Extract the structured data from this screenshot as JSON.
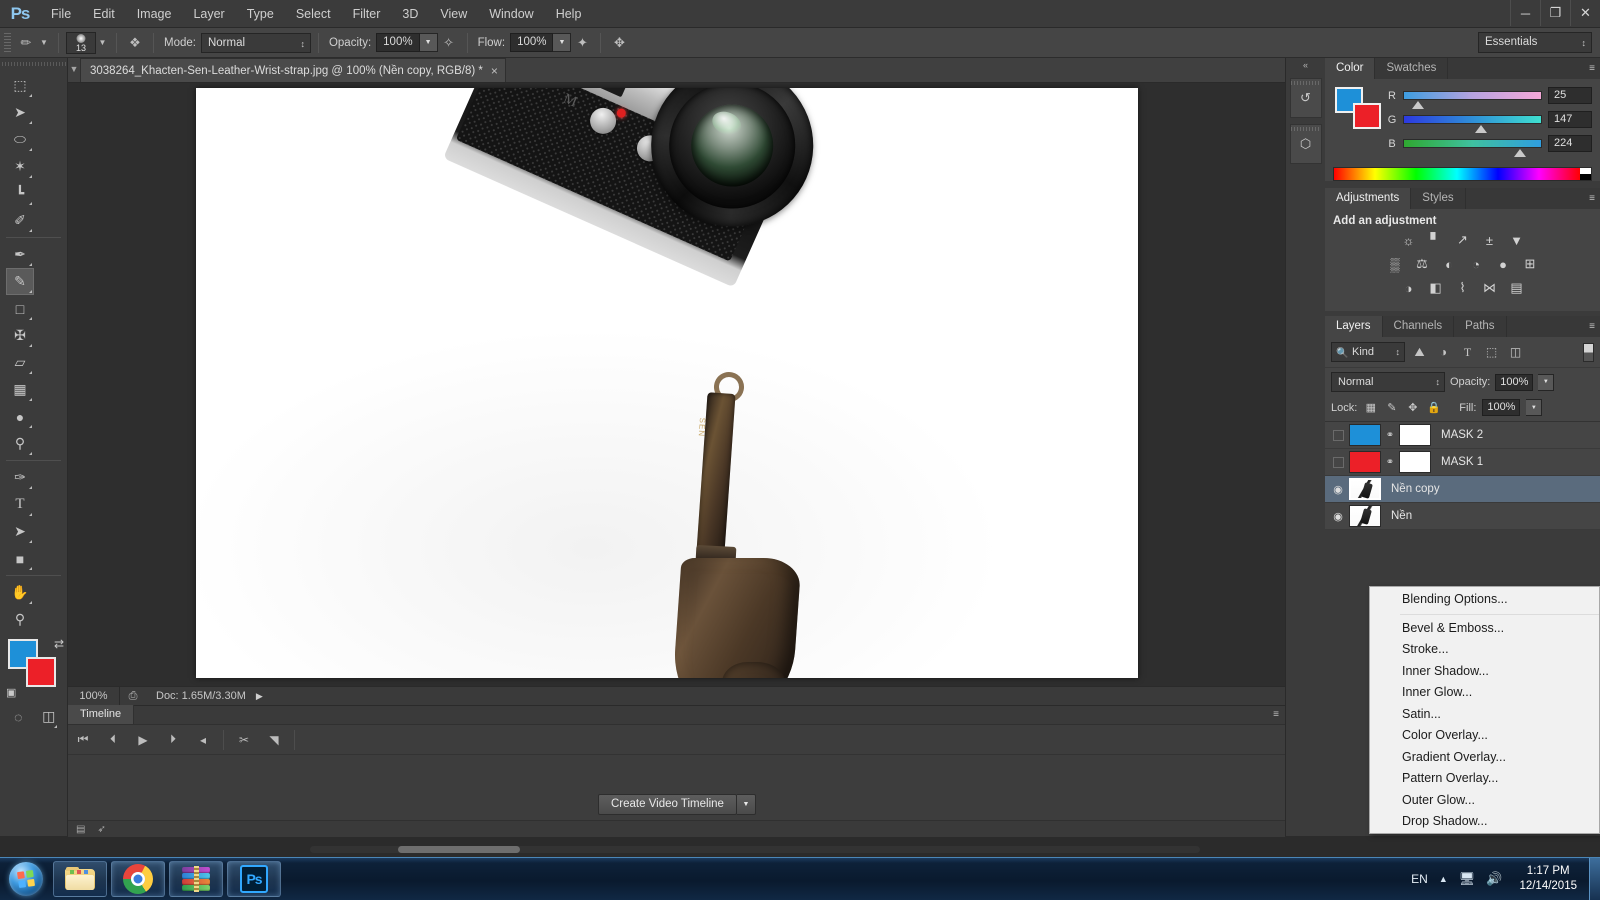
{
  "app": {
    "logo": "Ps",
    "workspace": "Essentials"
  },
  "menubar": {
    "items": [
      {
        "label": "File"
      },
      {
        "label": "Edit"
      },
      {
        "label": "Image"
      },
      {
        "label": "Layer"
      },
      {
        "label": "Type"
      },
      {
        "label": "Select"
      },
      {
        "label": "Filter"
      },
      {
        "label": "3D"
      },
      {
        "label": "View"
      },
      {
        "label": "Window"
      },
      {
        "label": "Help"
      }
    ]
  },
  "window_controls": {
    "minimize": "─",
    "restore": "❐",
    "close": "✕"
  },
  "options_bar": {
    "brush_size": "13",
    "mode_label": "Mode:",
    "mode_value": "Normal",
    "opacity_label": "Opacity:",
    "opacity_value": "100%",
    "flow_label": "Flow:",
    "flow_value": "100%"
  },
  "document": {
    "tab_title": "3038264_Khacten-Sen-Leather-Wrist-strap.jpg @ 100% (Nền copy, RGB/8) *",
    "close_glyph": "×"
  },
  "status_bar": {
    "zoom": "100%",
    "doc_info": "Doc: 1.65M/3.30M",
    "arrow": "▶"
  },
  "toolbox": {
    "tools": [
      {
        "name": "marquee-tool",
        "glyph": "⬚"
      },
      {
        "name": "move-tool",
        "glyph": "➤"
      },
      {
        "name": "lasso-tool",
        "glyph": "⬭"
      },
      {
        "name": "quick-selection-tool",
        "glyph": "✦"
      },
      {
        "name": "crop-tool",
        "glyph": "⌗"
      },
      {
        "name": "eyedropper-tool",
        "glyph": "✐"
      },
      {
        "name": "healing-brush-tool",
        "glyph": "✒"
      },
      {
        "name": "brush-tool",
        "glyph": "✎"
      },
      {
        "name": "clone-stamp-tool",
        "glyph": "⚑"
      },
      {
        "name": "history-brush-tool",
        "glyph": "✄"
      },
      {
        "name": "eraser-tool",
        "glyph": "▱"
      },
      {
        "name": "gradient-tool",
        "glyph": "▤"
      },
      {
        "name": "blur-tool",
        "glyph": "●"
      },
      {
        "name": "dodge-tool",
        "glyph": "○"
      },
      {
        "name": "pen-tool",
        "glyph": "✑"
      },
      {
        "name": "type-tool",
        "glyph": "T"
      },
      {
        "name": "path-selection-tool",
        "glyph": "➤"
      },
      {
        "name": "rectangle-tool",
        "glyph": "■"
      },
      {
        "name": "hand-tool",
        "glyph": "✋"
      },
      {
        "name": "zoom-tool",
        "glyph": "⚲"
      }
    ],
    "active_tool": "brush-tool",
    "foreground_color": "#1e90d8",
    "background_color": "#ec2028",
    "quick_mask_glyph": "◎",
    "screen_mode_glyph": "❐"
  },
  "color_panel": {
    "tabs": [
      {
        "label": "Color",
        "active": true
      },
      {
        "label": "Swatches",
        "active": false
      }
    ],
    "channels": [
      {
        "label": "R",
        "value": "25",
        "thumb_pct": 10
      },
      {
        "label": "G",
        "value": "147",
        "thumb_pct": 57
      },
      {
        "label": "B",
        "value": "224",
        "thumb_pct": 87
      }
    ],
    "foreground_color": "#1e90d8",
    "background_color": "#ec2028",
    "menu_glyph": "≡"
  },
  "adjustments_panel": {
    "tabs": [
      {
        "label": "Adjustments",
        "active": true
      },
      {
        "label": "Styles",
        "active": false
      }
    ],
    "title": "Add an adjustment",
    "rows": [
      [
        {
          "name": "brightness-contrast-icon",
          "glyph": "☀"
        },
        {
          "name": "levels-icon",
          "glyph": "▐"
        },
        {
          "name": "curves-icon",
          "glyph": "↗"
        },
        {
          "name": "exposure-icon",
          "glyph": "±"
        },
        {
          "name": "vibrance-icon",
          "glyph": "▼"
        }
      ],
      [
        {
          "name": "hue-saturation-icon",
          "glyph": "▒"
        },
        {
          "name": "color-balance-icon",
          "glyph": "⚖"
        },
        {
          "name": "black-white-icon",
          "glyph": "◐"
        },
        {
          "name": "photo-filter-icon",
          "glyph": "◔"
        },
        {
          "name": "channel-mixer-icon",
          "glyph": "●"
        },
        {
          "name": "color-lookup-icon",
          "glyph": "⊞"
        }
      ],
      [
        {
          "name": "invert-icon",
          "glyph": "◑"
        },
        {
          "name": "posterize-icon",
          "glyph": "◧"
        },
        {
          "name": "threshold-icon",
          "glyph": "⌇"
        },
        {
          "name": "gradient-map-icon",
          "glyph": "⋈"
        },
        {
          "name": "selective-color-icon",
          "glyph": "▤"
        }
      ]
    ],
    "menu_glyph": "≡"
  },
  "layers_panel": {
    "tabs": [
      {
        "label": "Layers",
        "active": true
      },
      {
        "label": "Channels",
        "active": false
      },
      {
        "label": "Paths",
        "active": false
      }
    ],
    "filter_kind": "Kind",
    "filter_icons": [
      {
        "name": "filter-pixel-icon",
        "glyph": "⛰"
      },
      {
        "name": "filter-adjustment-icon",
        "glyph": "◑"
      },
      {
        "name": "filter-type-icon",
        "glyph": "T"
      },
      {
        "name": "filter-shape-icon",
        "glyph": "⬚"
      },
      {
        "name": "filter-smart-object-icon",
        "glyph": "❐"
      }
    ],
    "blend_mode": "Normal",
    "opacity_label": "Opacity:",
    "opacity_value": "100%",
    "lock_label": "Lock:",
    "lock_icons": [
      {
        "name": "lock-transparency-icon",
        "glyph": "▦"
      },
      {
        "name": "lock-image-icon",
        "glyph": "✎"
      },
      {
        "name": "lock-position-icon",
        "glyph": "✥"
      },
      {
        "name": "lock-all-icon",
        "glyph": "ὑ2"
      }
    ],
    "fill_label": "Fill:",
    "fill_value": "100%",
    "layers": [
      {
        "name": "MASK 2",
        "visible": false,
        "selected": false,
        "thumb": "blue",
        "has_mask": true,
        "mask_thumb": "white"
      },
      {
        "name": "MASK 1",
        "visible": false,
        "selected": false,
        "thumb": "red",
        "has_mask": true,
        "mask_thumb": "white"
      },
      {
        "name": "Nền copy",
        "visible": true,
        "selected": true,
        "thumb": "img",
        "has_mask": false
      },
      {
        "name": "Nền",
        "visible": true,
        "selected": false,
        "thumb": "img",
        "has_mask": false
      }
    ],
    "eye_glyph": "◉",
    "link_glyph": "⚭",
    "menu_glyph": "≡"
  },
  "context_menu": {
    "items": [
      {
        "label": "Blending Options...",
        "separator_after": true
      },
      {
        "label": "Bevel & Emboss...",
        "separator_after": false
      },
      {
        "label": "Stroke...",
        "separator_after": false
      },
      {
        "label": "Inner Shadow...",
        "separator_after": false
      },
      {
        "label": "Inner Glow...",
        "separator_after": false
      },
      {
        "label": "Satin...",
        "separator_after": false
      },
      {
        "label": "Color Overlay...",
        "separator_after": false
      },
      {
        "label": "Gradient Overlay...",
        "separator_after": false
      },
      {
        "label": "Pattern Overlay...",
        "separator_after": false
      },
      {
        "label": "Outer Glow...",
        "separator_after": false
      },
      {
        "label": "Drop Shadow...",
        "separator_after": false
      }
    ]
  },
  "timeline_panel": {
    "tab_label": "Timeline",
    "menu_glyph": "≡",
    "controls": [
      {
        "name": "go-to-first-frame-button",
        "glyph": "⏮"
      },
      {
        "name": "previous-frame-button",
        "glyph": "⏴"
      },
      {
        "name": "play-button",
        "glyph": "▶"
      },
      {
        "name": "next-frame-button",
        "glyph": "⏵"
      },
      {
        "name": "audio-button",
        "glyph": "◂"
      },
      {
        "name": "split-clip-button",
        "glyph": "✂"
      },
      {
        "name": "transition-button",
        "glyph": "◥"
      }
    ],
    "create_button": "Create Video Timeline",
    "create_dropdown_glyph": "▼",
    "footer_icons": [
      {
        "name": "frame-view-icon",
        "glyph": "▤"
      },
      {
        "name": "share-icon",
        "glyph": "➦"
      }
    ]
  },
  "dock_rail": {
    "collapse_glyph": "«",
    "items": [
      {
        "name": "history-rail-icon",
        "glyph": "↺"
      },
      {
        "name": "3d-rail-icon",
        "glyph": "⬡"
      }
    ]
  },
  "taskbar": {
    "apps": [
      {
        "name": "windows-explorer-taskbar-button"
      },
      {
        "name": "google-chrome-taskbar-button"
      },
      {
        "name": "winrar-taskbar-button"
      },
      {
        "name": "photoshop-taskbar-button",
        "label": "Ps"
      }
    ],
    "tray": {
      "language": "EN",
      "show_hidden_glyph": "▲",
      "network_glyph": "⌸",
      "volume_glyph": "ὐa",
      "time": "1:17 PM",
      "date": "12/14/2015"
    }
  },
  "canvas": {
    "image_alt": "Leica M camera with brown leather wrist strap on white background",
    "strap_brand": "SEN"
  }
}
